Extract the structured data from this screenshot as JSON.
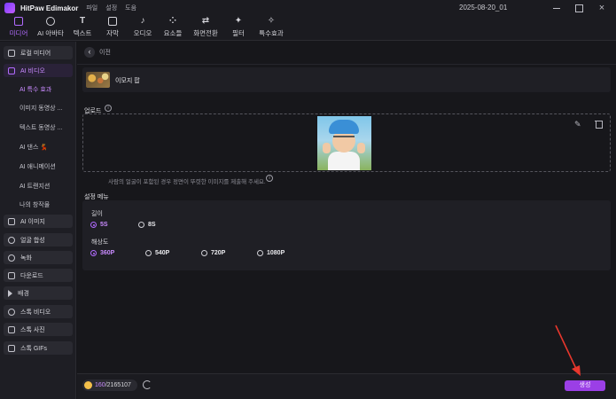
{
  "titlebar": {
    "app_name": "HitPaw Edimakor",
    "menus": [
      "파일",
      "설정",
      "도움"
    ],
    "date": "2025-08-20_01"
  },
  "toolbar": {
    "tabs": [
      {
        "label": "미디어",
        "icon": "media-icon",
        "active": true
      },
      {
        "label": "AI 아바타",
        "icon": "avatar-icon",
        "active": false
      },
      {
        "label": "텍스트",
        "icon": "text-icon",
        "active": false
      },
      {
        "label": "자막",
        "icon": "subtitle-icon",
        "active": false
      },
      {
        "label": "오디오",
        "icon": "audio-icon",
        "active": false
      },
      {
        "label": "요소들",
        "icon": "elements-icon",
        "active": false
      },
      {
        "label": "화면전환",
        "icon": "transition-icon",
        "active": false
      },
      {
        "label": "필터",
        "icon": "filter-icon",
        "active": false
      },
      {
        "label": "특수효과",
        "icon": "effects-icon",
        "active": false
      }
    ]
  },
  "sidebar": {
    "local_media": "로컬 미디어",
    "ai_video": "AI 비디오",
    "sub_items": [
      "AI 특수 효과",
      "이미지 동영상 ...",
      "텍스트 동영상 ...",
      "AI 댄스 💃",
      "AI 애니메이션",
      "AI 트랜지션",
      "나의 창작물"
    ],
    "groups": [
      "AI 이미지",
      "얼굴 합성",
      "녹화",
      "다운로드",
      "배경",
      "스톡 비디오",
      "스톡 사진",
      "스톡 GIFs"
    ]
  },
  "main": {
    "back_label": "이전",
    "template_name": "이모지 팝",
    "upload_title": "업로드",
    "upload_hint": "사람의 얼굴이 포함된 경우 정면이 뚜렷한 이미지를 제출해 주세요.",
    "settings_title": "설정 메뉴",
    "duration_label": "길이",
    "durations": [
      "5S",
      "8S"
    ],
    "resolution_label": "해상도",
    "resolutions": [
      "360P",
      "540P",
      "720P",
      "1080P"
    ],
    "credits_used": "160",
    "credits_total": "/2165107",
    "generate_label": "생성"
  },
  "colors": {
    "accent": "#b26bff",
    "generate": "#9b3fe6",
    "annotation_arrow": "#e8372d"
  }
}
